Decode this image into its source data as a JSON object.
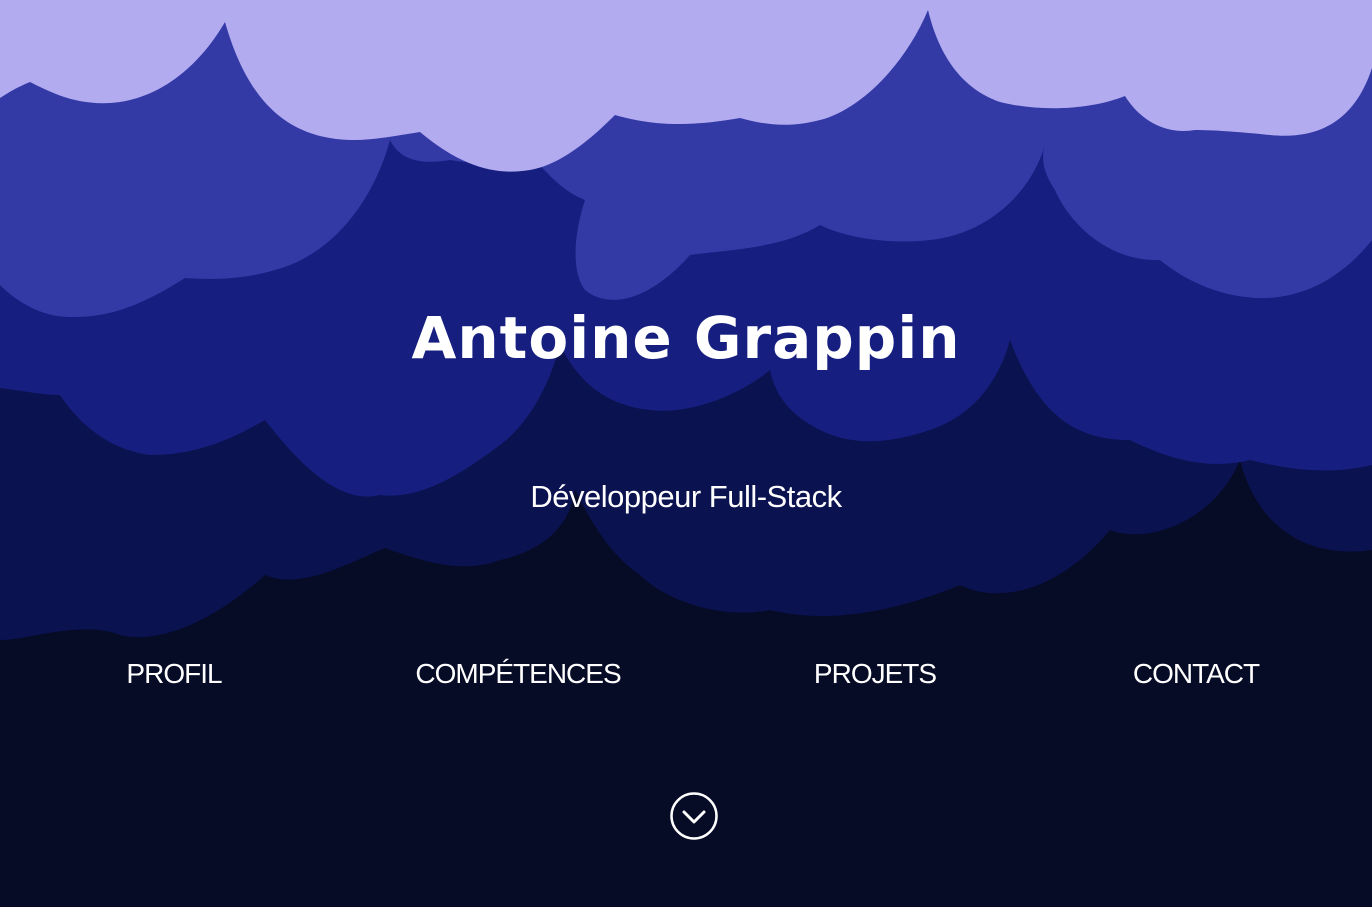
{
  "hero": {
    "name": "Antoine Grappin",
    "subtitle": "Développeur Full-Stack"
  },
  "nav": {
    "items": [
      {
        "label": "PROFIL"
      },
      {
        "label": "COMPÉTENCES"
      },
      {
        "label": "PROJETS"
      },
      {
        "label": "CONTACT"
      }
    ]
  },
  "scroll_button": {
    "icon": "chevron-down-icon"
  },
  "colors": {
    "sky": "#b3abf0",
    "cloud_layer_1": "#333aa6",
    "cloud_layer_2": "#161f80",
    "cloud_layer_3": "#0b1250",
    "background": "#060b26",
    "text": "#ffffff"
  }
}
